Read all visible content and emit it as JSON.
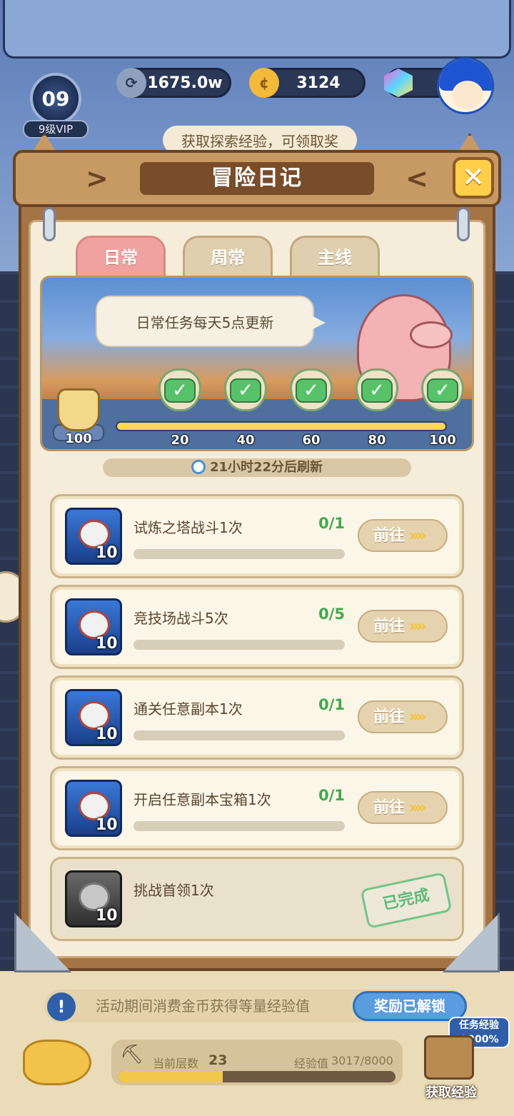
{
  "hud": {
    "vip_level": "09",
    "vip_label": "9级VIP",
    "coins": "1675.0w",
    "gold": "3124",
    "hint_text": "获取探索经验，可领取奖"
  },
  "dialog": {
    "title": "冒险日记",
    "prev_arrow": ">",
    "next_arrow": "<",
    "close_symbol": "✕"
  },
  "tabs": [
    {
      "label": "日常",
      "active": true
    },
    {
      "label": "周常",
      "active": false
    },
    {
      "label": "主线",
      "active": false
    }
  ],
  "banner": {
    "bubble_text": "日常任务每天5点更新",
    "start_value": "100",
    "progress_fraction": 1.0,
    "milestones": [
      {
        "label": "20",
        "claimed": true
      },
      {
        "label": "40",
        "claimed": true
      },
      {
        "label": "60",
        "claimed": true
      },
      {
        "label": "80",
        "claimed": true
      },
      {
        "label": "100",
        "claimed": true
      }
    ],
    "refresh_text": "21小时22分后刷新"
  },
  "tasks": [
    {
      "icon": "wing-badge-icon",
      "reward": "10",
      "title": "试炼之塔战斗1次",
      "count": "0/1",
      "button": "前往",
      "done": false
    },
    {
      "icon": "wing-badge-icon",
      "reward": "10",
      "title": "竞技场战斗5次",
      "count": "0/5",
      "button": "前往",
      "done": false
    },
    {
      "icon": "wing-badge-icon",
      "reward": "10",
      "title": "通关任意副本1次",
      "count": "0/1",
      "button": "前往",
      "done": false
    },
    {
      "icon": "wing-badge-icon",
      "reward": "10",
      "title": "开启任意副本宝箱1次",
      "count": "0/1",
      "button": "前往",
      "done": false
    },
    {
      "icon": "wing-badge-icon",
      "reward": "10",
      "title": "挑战首领1次",
      "count": "",
      "button": "",
      "done": true,
      "stamp": "已完成"
    }
  ],
  "go_arrows": "»»",
  "bottom": {
    "notice_icon": "!",
    "notice_text": "活动期间消费金币获得等量经验值",
    "unlock_label": "奖励已解锁",
    "bonus_line1": "任务经验",
    "bonus_line2": "⌃200%",
    "floor_label": "当前层数",
    "floor_value": "23",
    "exp_label": "经验值",
    "exp_value": "3017/8000",
    "exp_fraction": 0.377,
    "get_exp_label": "获取经验"
  }
}
